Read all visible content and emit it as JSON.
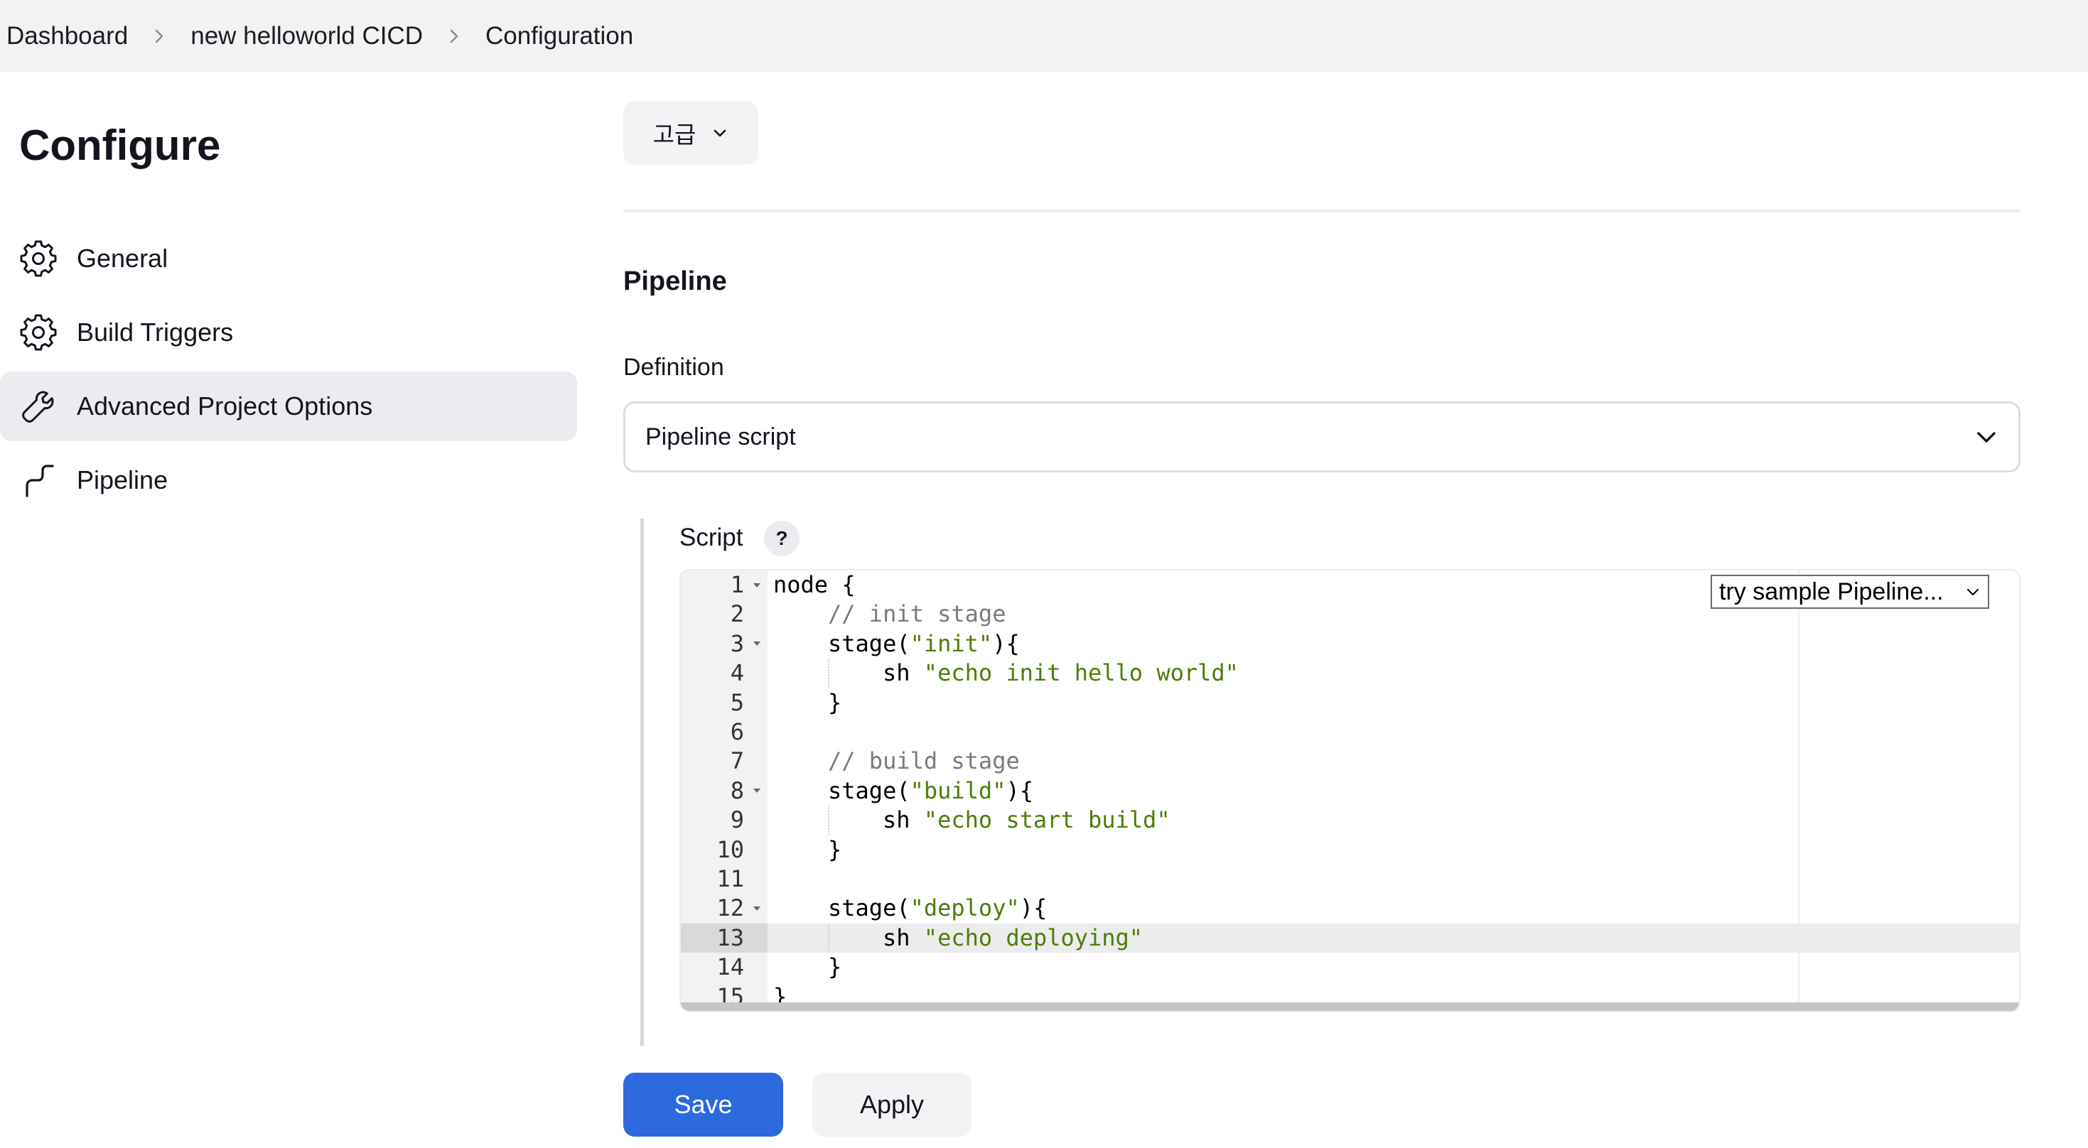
{
  "breadcrumb": {
    "items": [
      "Dashboard",
      "new helloworld CICD",
      "Configuration"
    ]
  },
  "sidebar": {
    "title": "Configure",
    "items": [
      {
        "label": "General",
        "icon": "gear-icon"
      },
      {
        "label": "Build Triggers",
        "icon": "gear-icon"
      },
      {
        "label": "Advanced Project Options",
        "icon": "wrench-icon",
        "active": true
      },
      {
        "label": "Pipeline",
        "icon": "pipeline-icon"
      }
    ]
  },
  "advanced": {
    "label": "고급"
  },
  "pipeline": {
    "section_title": "Pipeline",
    "definition_label": "Definition",
    "definition_value": "Pipeline script",
    "script_label": "Script",
    "help_label": "?",
    "sample_select": "try sample Pipeline...",
    "lines": [
      {
        "n": "1",
        "fold": true,
        "indent": 0,
        "tokens": [
          {
            "t": "node {",
            "k": "plain"
          }
        ]
      },
      {
        "n": "2",
        "fold": false,
        "indent": 1,
        "tokens": [
          {
            "t": "// init stage",
            "k": "comment"
          }
        ]
      },
      {
        "n": "3",
        "fold": true,
        "indent": 1,
        "tokens": [
          {
            "t": "stage(",
            "k": "plain"
          },
          {
            "t": "\"init\"",
            "k": "string"
          },
          {
            "t": "){",
            "k": "plain"
          }
        ]
      },
      {
        "n": "4",
        "fold": false,
        "indent": 2,
        "tokens": [
          {
            "t": "sh ",
            "k": "plain"
          },
          {
            "t": "\"echo init hello world\"",
            "k": "string"
          }
        ]
      },
      {
        "n": "5",
        "fold": false,
        "indent": 1,
        "tokens": [
          {
            "t": "}",
            "k": "plain"
          }
        ]
      },
      {
        "n": "6",
        "fold": false,
        "indent": 0,
        "tokens": []
      },
      {
        "n": "7",
        "fold": false,
        "indent": 1,
        "tokens": [
          {
            "t": "// build stage",
            "k": "comment"
          }
        ]
      },
      {
        "n": "8",
        "fold": true,
        "indent": 1,
        "tokens": [
          {
            "t": "stage(",
            "k": "plain"
          },
          {
            "t": "\"build\"",
            "k": "string"
          },
          {
            "t": "){",
            "k": "plain"
          }
        ]
      },
      {
        "n": "9",
        "fold": false,
        "indent": 2,
        "tokens": [
          {
            "t": "sh ",
            "k": "plain"
          },
          {
            "t": "\"echo start build\"",
            "k": "string"
          }
        ]
      },
      {
        "n": "10",
        "fold": false,
        "indent": 1,
        "tokens": [
          {
            "t": "}",
            "k": "plain"
          }
        ]
      },
      {
        "n": "11",
        "fold": false,
        "indent": 0,
        "tokens": []
      },
      {
        "n": "12",
        "fold": true,
        "indent": 1,
        "tokens": [
          {
            "t": "stage(",
            "k": "plain"
          },
          {
            "t": "\"deploy\"",
            "k": "string"
          },
          {
            "t": "){",
            "k": "plain"
          }
        ]
      },
      {
        "n": "13",
        "fold": false,
        "indent": 2,
        "active": true,
        "tokens": [
          {
            "t": "sh ",
            "k": "plain"
          },
          {
            "t": "\"echo deploying\"",
            "k": "string"
          }
        ]
      },
      {
        "n": "14",
        "fold": false,
        "indent": 1,
        "tokens": [
          {
            "t": "}",
            "k": "plain"
          }
        ]
      },
      {
        "n": "15",
        "fold": false,
        "indent": 0,
        "tokens": [
          {
            "t": "}",
            "k": "plain"
          }
        ]
      }
    ]
  },
  "actions": {
    "save_label": "Save",
    "apply_label": "Apply"
  },
  "colors": {
    "primary": "#2c69de",
    "string": "#4d7d08",
    "comment": "#7b7b7b"
  }
}
